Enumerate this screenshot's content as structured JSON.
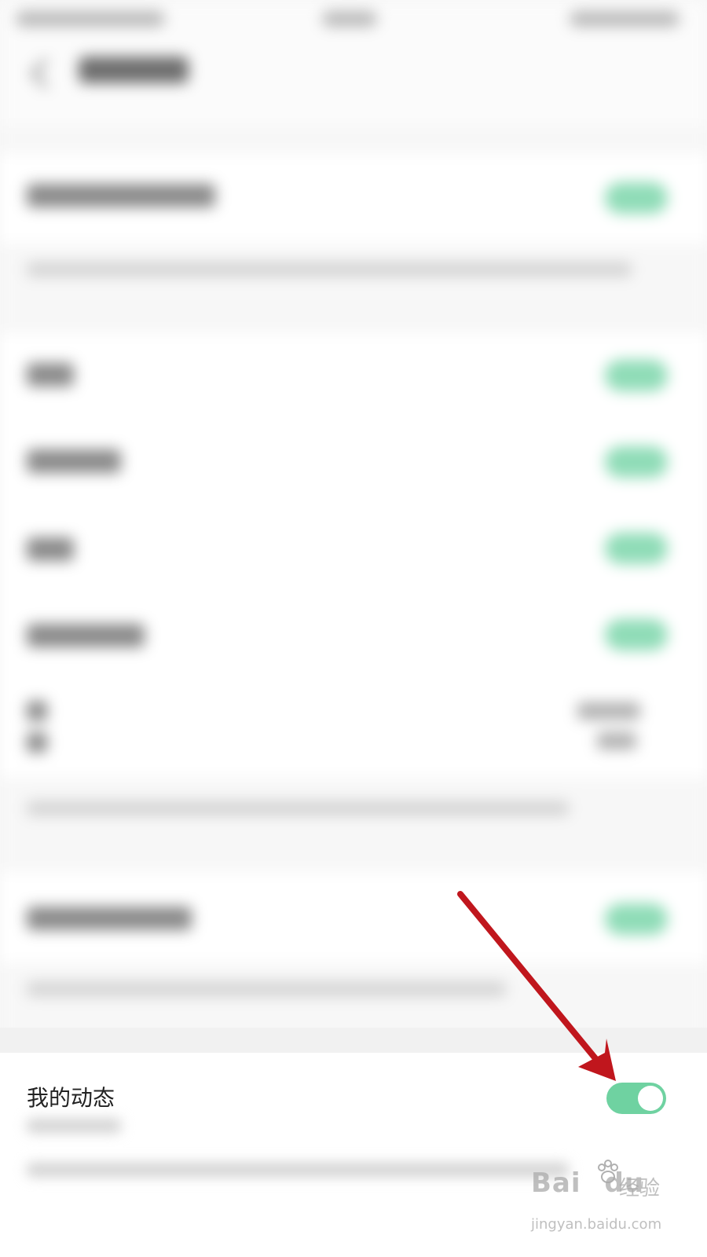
{
  "setting": {
    "label": "我的动态",
    "enabled": true,
    "toggle_on_color": "#6fd2a1"
  },
  "watermark": {
    "brand": "Bai",
    "brand_suffix": "du",
    "product": "经验",
    "url": "jingyan.baidu.com"
  },
  "annotation": {
    "arrow_color": "#c0161d"
  }
}
